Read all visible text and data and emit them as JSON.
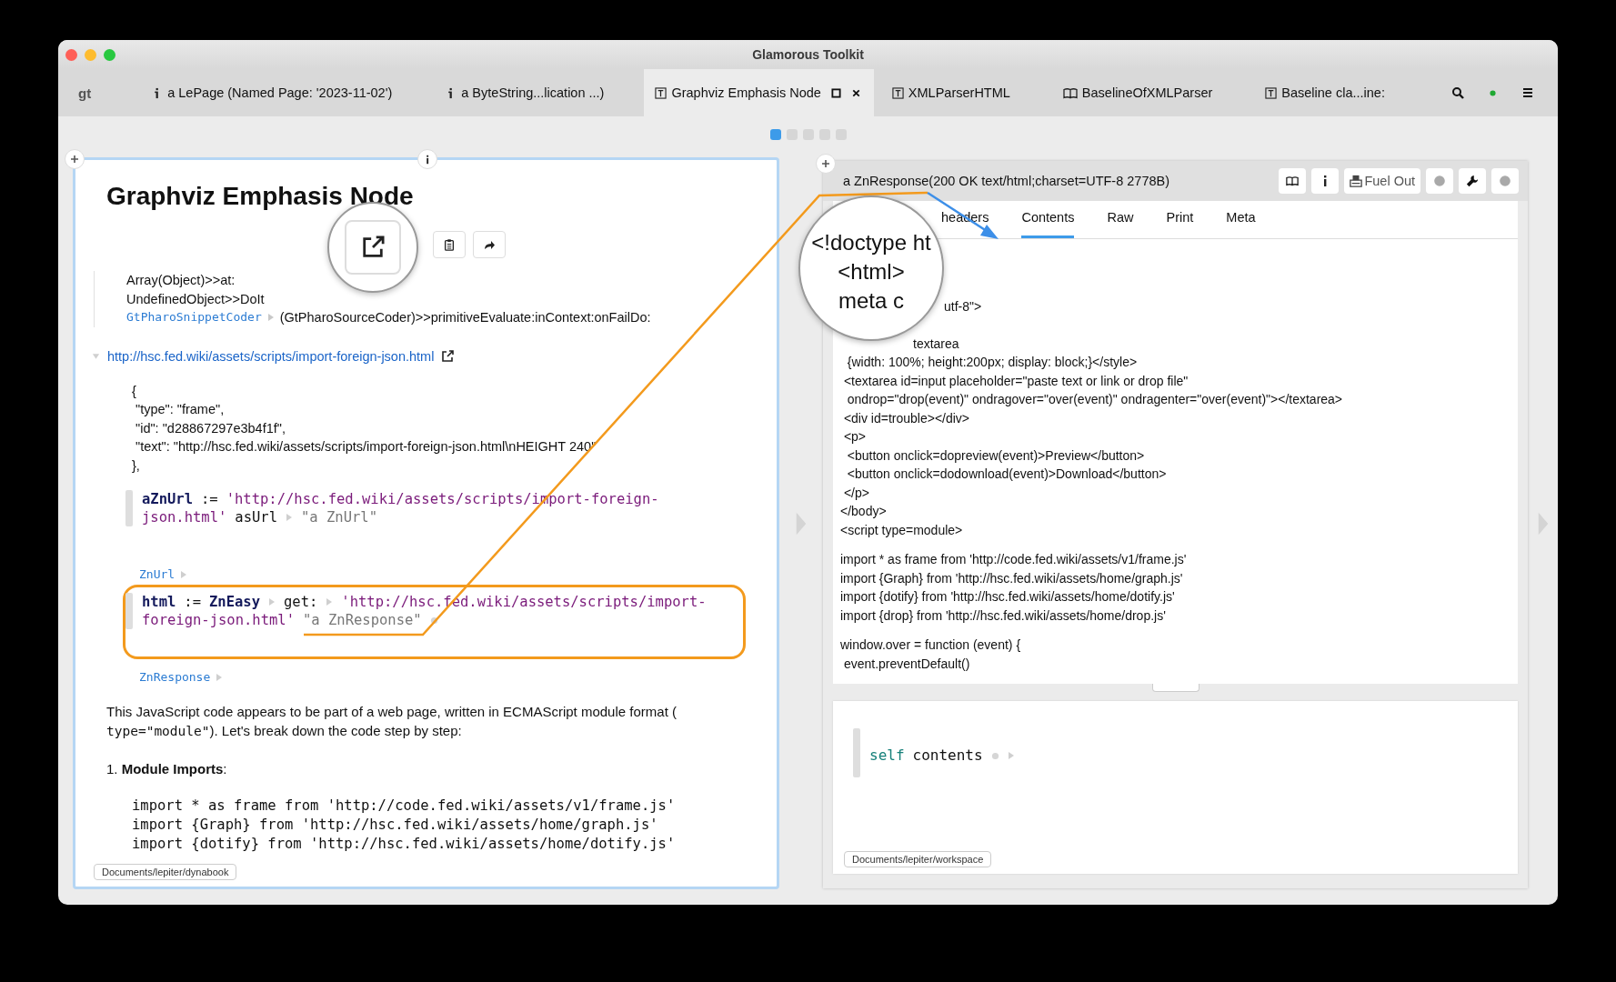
{
  "window": {
    "title": "Glamorous Toolkit"
  },
  "tabs": [
    {
      "kind": "logo",
      "label": "gt",
      "selected": false
    },
    {
      "kind": "info",
      "label": "a LePage (Named Page: '2023-11-02')",
      "selected": false
    },
    {
      "kind": "info",
      "label": "a ByteString...lication ...)",
      "selected": false
    },
    {
      "kind": "class",
      "label": "Graphviz Emphasis Node",
      "selected": true
    },
    {
      "kind": "class",
      "label": "XMLParserHTML",
      "selected": false
    },
    {
      "kind": "book",
      "label": "BaselineOfXMLParser",
      "selected": false
    },
    {
      "kind": "class",
      "label": "Baseline cla...ine:",
      "selected": false
    }
  ],
  "pager": [
    {
      "selected": true
    },
    {
      "selected": false
    },
    {
      "selected": false
    },
    {
      "selected": false
    },
    {
      "selected": false
    }
  ],
  "page": {
    "title": "Graphviz Emphasis Node",
    "trace": [
      {
        "kind": "text",
        "text": "Array(Object)>>at:"
      },
      {
        "kind": "text",
        "text": "UndefinedObject>>DoIt"
      },
      {
        "kind": "coder",
        "coder": "GtPharoSnippetCoder",
        "text": "(GtPharoSourceCoder)>>primitiveEvaluate:inContext:onFailDo:"
      }
    ],
    "link": "http://hsc.fed.wiki/assets/scripts/import-foreign-json.html",
    "json_lines": [
      "{",
      " \"type\": \"frame\",",
      " \"id\": \"d28867297e3b4f1f\",",
      " \"text\": \"http://hsc.fed.wiki/assets/scripts/import-foreign-json.html\\nHEIGHT 240\"",
      "},"
    ],
    "snippets": [
      {
        "highlighted": false,
        "result_class": "ZnUrl",
        "lines": [
          [
            {
              "kind": "var",
              "text": "aZnUrl"
            },
            {
              "kind": "plain",
              "text": ":="
            },
            {
              "kind": "string",
              "text": "'http://hsc.fed.wiki/assets/scripts/import-foreign-"
            }
          ],
          [
            {
              "kind": "string",
              "text": "json.html'"
            },
            {
              "kind": "plain",
              "text": "asUrl"
            },
            {
              "kind": "expander"
            },
            {
              "kind": "result",
              "text": "\"a ZnUrl\""
            }
          ]
        ]
      },
      {
        "highlighted": true,
        "result_class": "ZnResponse",
        "lines": [
          [
            {
              "kind": "var",
              "text": "html"
            },
            {
              "kind": "plain",
              "text": ":="
            },
            {
              "kind": "var",
              "text": "ZnEasy"
            },
            {
              "kind": "expander"
            },
            {
              "kind": "plain",
              "text": "get:"
            },
            {
              "kind": "expander"
            },
            {
              "kind": "string",
              "text": "'http://hsc.fed.wiki/assets/scripts/import-"
            }
          ],
          [
            {
              "kind": "string",
              "text": "foreign-json.html'"
            },
            {
              "kind": "result",
              "text": "\"a ZnResponse\""
            },
            {
              "kind": "dot"
            }
          ]
        ]
      }
    ],
    "paragraph": {
      "before": "This JavaScript code appears to be part of a web page, written in ECMAScript module format (",
      "code": "type=\"module\"",
      "after": "). Let's break down the code step by step:"
    },
    "list_item": "1. **Module Imports**:",
    "code_lines": [
      "import * as frame from 'http://code.fed.wiki/assets/v1/frame.js'",
      "import {Graph} from 'http://hsc.fed.wiki/assets/home/graph.js'",
      "import {dotify} from 'http://hsc.fed.wiki/assets/home/dotify.js'"
    ],
    "path": "Documents/lepiter/dynabook"
  },
  "inspector": {
    "title": "a ZnResponse(200 OK text/html;charset=UTF-8 2778B)",
    "fuel_button": "Fuel Out",
    "tabs": [
      {
        "label": "headers",
        "selected": false
      },
      {
        "label": "Contents",
        "selected": true
      },
      {
        "label": "Raw",
        "selected": false
      },
      {
        "label": "Print",
        "selected": false
      },
      {
        "label": "Meta",
        "selected": false
      }
    ],
    "lens_lines": [
      "<!doctype ht",
      "<html>",
      "meta c"
    ],
    "blocks": [
      [
        "utf-8\">",
        "textarea",
        "  {width: 100%; height:200px; display: block;}</style>",
        " <textarea id=input placeholder=\"paste text or link or drop file\"",
        "  ondrop=\"drop(event)\" ondragover=\"over(event)\" ondragenter=\"over(event)\"></textarea>",
        " <div id=trouble></div>",
        " <p>",
        "  <button onclick=dopreview(event)>Preview</button>",
        "  <button onclick=dodownload(event)>Download</button>",
        " </p>",
        "</body>",
        "<script type=module>"
      ],
      [
        "import * as frame from 'http://code.fed.wiki/assets/v1/frame.js'",
        "import {Graph} from 'http://hsc.fed.wiki/assets/home/graph.js'",
        "import {dotify} from 'http://hsc.fed.wiki/assets/home/dotify.js'",
        "import {drop} from 'http://hsc.fed.wiki/assets/home/drop.js'"
      ],
      [
        "window.over = function (event) {",
        " event.preventDefault()"
      ]
    ],
    "playground": {
      "tokens": [
        {
          "kind": "self",
          "text": "self"
        },
        {
          "kind": "plain",
          "text": "contents"
        },
        {
          "kind": "dot"
        },
        {
          "kind": "expander"
        }
      ],
      "path": "Documents/lepiter/workspace"
    }
  }
}
